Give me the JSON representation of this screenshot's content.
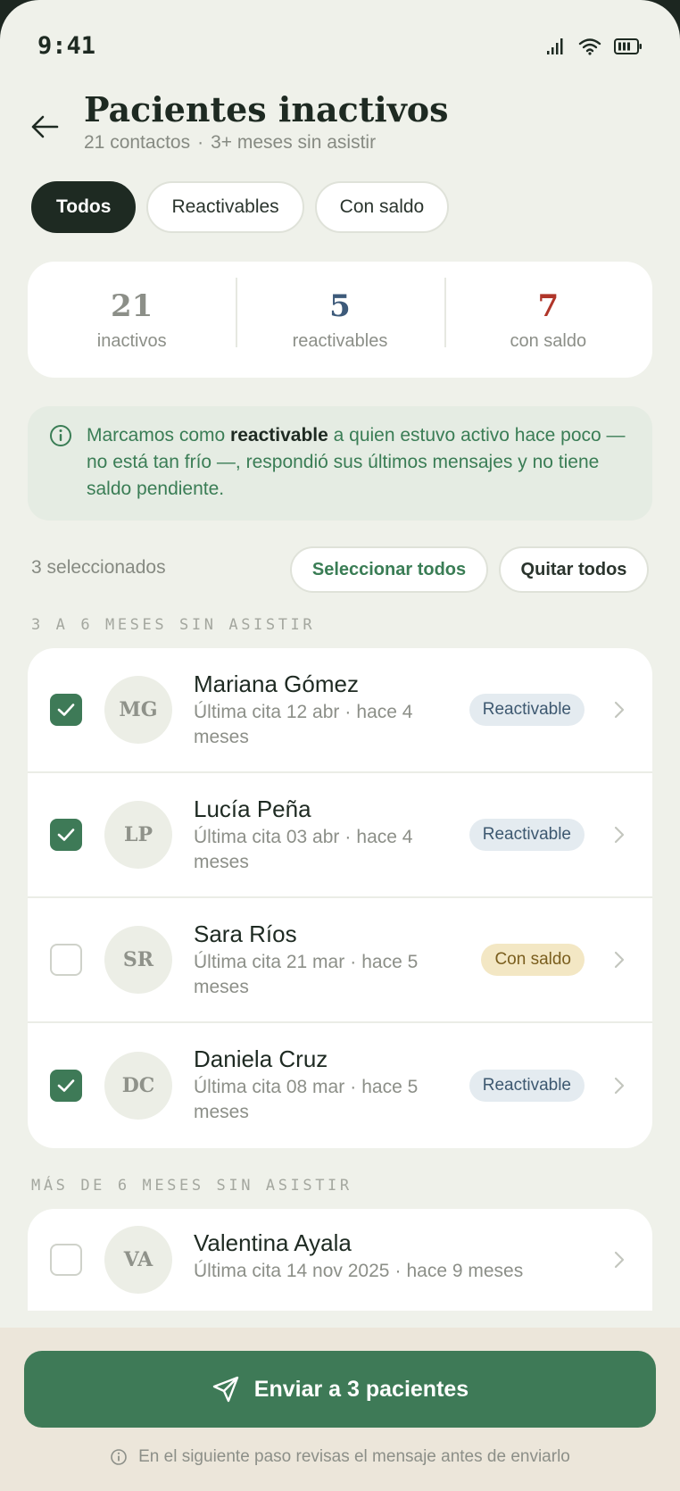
{
  "status_bar": {
    "time": "9:41",
    "icons": [
      "signal-icon",
      "wifi-icon",
      "battery-icon"
    ]
  },
  "header": {
    "title": "Pacientes inactivos",
    "subtitle_count": "21 contactos",
    "subtitle_separator": "·",
    "subtitle_detail": "3+ meses sin asistir"
  },
  "filters": [
    {
      "label": "Todos",
      "active": true
    },
    {
      "label": "Reactivables",
      "active": false
    },
    {
      "label": "Con saldo",
      "active": false
    }
  ],
  "stats": [
    {
      "value": "21",
      "label": "inactivos",
      "color": "#8c8f88"
    },
    {
      "value": "5",
      "label": "reactivables",
      "color": "#3d5a7a"
    },
    {
      "value": "7",
      "label": "con saldo",
      "color": "#b0362a"
    }
  ],
  "info": {
    "before": "Marcamos como ",
    "bold": "reactivable",
    "after": " a quien estuvo activo hace poco — no está tan frío —, respondió sus últimos mensajes y no tiene saldo pendiente."
  },
  "selection": {
    "count_label": "3 seleccionados",
    "select_all": "Seleccionar todos",
    "clear_all": "Quitar todos"
  },
  "sections": [
    {
      "label": "3 A 6 MESES SIN ASISTIR",
      "patients": [
        {
          "initials": "MG",
          "name": "Mariana Gómez",
          "last": "Última cita 12 abr",
          "ago": "hace 4 meses",
          "badge": "Reactivable",
          "badge_type": "reactivable",
          "checked": true
        },
        {
          "initials": "LP",
          "name": "Lucía Peña",
          "last": "Última cita 03 abr",
          "ago": "hace 4 meses",
          "badge": "Reactivable",
          "badge_type": "reactivable",
          "checked": true
        },
        {
          "initials": "SR",
          "name": "Sara Ríos",
          "last": "Última cita 21 mar",
          "ago": "hace 5 meses",
          "badge": "Con saldo",
          "badge_type": "saldo",
          "checked": false
        },
        {
          "initials": "DC",
          "name": "Daniela Cruz",
          "last": "Última cita 08 mar",
          "ago": "hace 5 meses",
          "badge": "Reactivable",
          "badge_type": "reactivable",
          "checked": true
        }
      ]
    },
    {
      "label": "MÁS DE 6 MESES SIN ASISTIR",
      "patients": [
        {
          "initials": "VA",
          "name": "Valentina Ayala",
          "last": "Última cita 14 nov 2025",
          "ago": "hace 9 meses",
          "badge": "",
          "badge_type": "",
          "checked": false
        }
      ]
    }
  ],
  "separator": "·",
  "send_button": {
    "label": "Enviar a 3 pacientes"
  },
  "hint": "En el siguiente paso revisas el mensaje antes de enviarlo",
  "colors": {
    "accent": "#3e7a57",
    "dark": "#1e2a22",
    "background": "#eff1ea"
  }
}
